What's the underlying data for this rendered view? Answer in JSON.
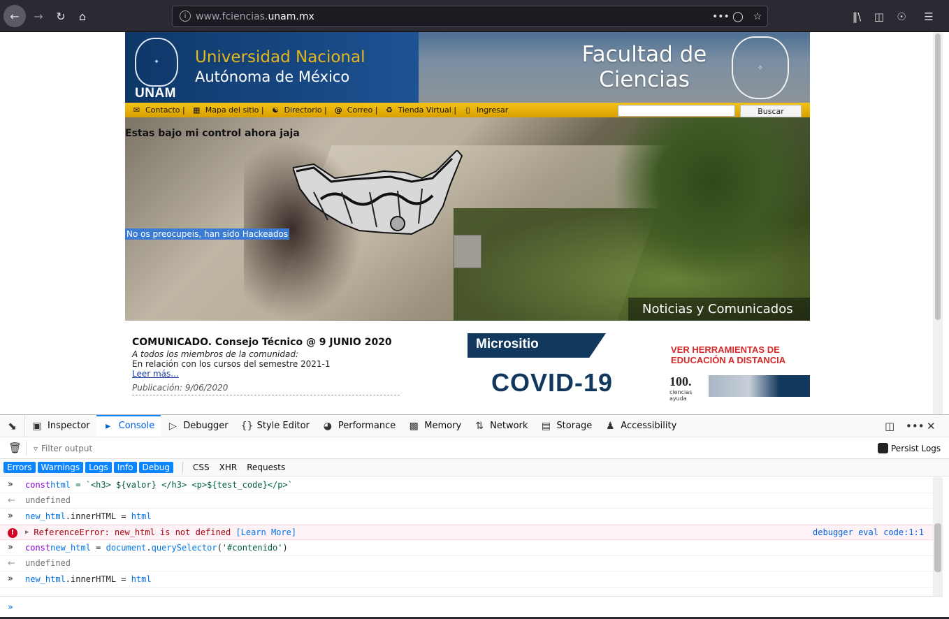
{
  "browser": {
    "url_host": "www.fciencias.",
    "url_domain": "unam.mx",
    "back_icon": "arrow-left",
    "forward_icon": "arrow-right",
    "reload_icon": "reload",
    "home_icon": "home"
  },
  "header": {
    "unam_label": "UNAM",
    "univ_line1": "Universidad Nacional",
    "univ_line2": "Autónoma de México",
    "faculty_line1": "Facultad de",
    "faculty_line2": "Ciencias"
  },
  "nav": {
    "items": [
      {
        "label": "Contacto |",
        "icon": "mail-icon"
      },
      {
        "label": "Mapa del sitio |",
        "icon": "sitemap-icon"
      },
      {
        "label": "Directorio |",
        "icon": "directory-icon"
      },
      {
        "label": "Correo |",
        "icon": "at-icon"
      },
      {
        "label": "Tienda Virtual |",
        "icon": "store-icon"
      },
      {
        "label": "Ingresar",
        "icon": "login-icon"
      }
    ],
    "search_button": "Buscar"
  },
  "hero": {
    "title": "Estas bajo mi control ahora jaja",
    "subtitle": "No os preocupeis, han sido Hackeados",
    "noticias": "Noticias y Comunicados"
  },
  "news": {
    "title": "COMUNICADO. Consejo Técnico @ 9 JUNIO 2020",
    "greeting": "A todos los miembros de la comunidad:",
    "body": "En relación con los cursos del semestre 2021-1",
    "more": "Leer más...",
    "date": "Publicación: 9/06/2020"
  },
  "banners": {
    "micrositio": "Micrositio",
    "covid": "COVID-19",
    "edu_line1": "VER HERRAMIENTAS DE",
    "edu_line2": "EDUCACIÓN A DISTANCIA",
    "ciencias_ayuda": "ciencias ayuda"
  },
  "devtools": {
    "tabs": [
      {
        "label": "Inspector",
        "icon": "inspector-icon"
      },
      {
        "label": "Console",
        "icon": "console-icon",
        "active": true
      },
      {
        "label": "Debugger",
        "icon": "debugger-icon"
      },
      {
        "label": "Style Editor",
        "icon": "style-editor-icon"
      },
      {
        "label": "Performance",
        "icon": "performance-icon"
      },
      {
        "label": "Memory",
        "icon": "memory-icon"
      },
      {
        "label": "Network",
        "icon": "network-icon"
      },
      {
        "label": "Storage",
        "icon": "storage-icon"
      },
      {
        "label": "Accessibility",
        "icon": "accessibility-icon"
      }
    ],
    "filter_placeholder": "Filter output",
    "persist_logs": "Persist Logs",
    "levels": [
      "Errors",
      "Warnings",
      "Logs",
      "Info",
      "Debug"
    ],
    "types": [
      "CSS",
      "XHR",
      "Requests"
    ],
    "console": {
      "line1": {
        "kw": "const",
        "var": "html",
        "rest": " = `<h3> ${valor} </h3> <p>${test_code}</p>`"
      },
      "line2": "undefined",
      "line3": {
        "var1": "new_html",
        "mid": ".innerHTML = ",
        "var2": "html"
      },
      "error": {
        "text": "ReferenceError: new_html is not defined ",
        "link": "[Learn More]",
        "source": "debugger eval code:1:1"
      },
      "line5": {
        "kw": "const",
        "var": "new_html",
        "eq": " = ",
        "doc": "document",
        "dot": ".",
        "fn": "querySelector",
        "arg": "'#contenido'",
        "close": ")"
      },
      "line6": "undefined",
      "line7": {
        "var1": "new_html",
        "mid": ".innerHTML = ",
        "var2": "html"
      }
    }
  }
}
